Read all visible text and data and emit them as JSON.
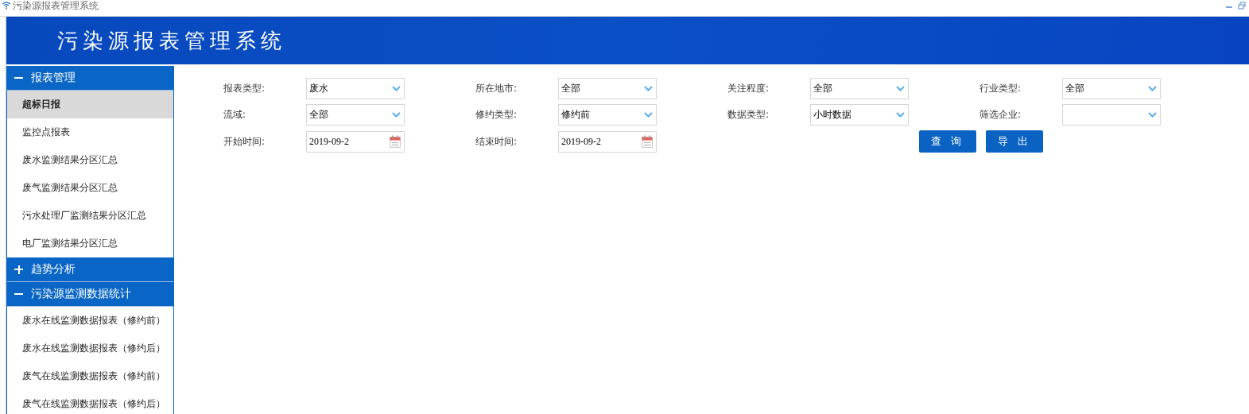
{
  "window": {
    "title": "污染源报表管理系统"
  },
  "header": {
    "title": "污染源报表管理系统"
  },
  "sidebar": {
    "groups": [
      {
        "label": "报表管理",
        "expanded": true,
        "items": [
          {
            "label": "超标日报",
            "selected": true
          },
          {
            "label": "监控点报表",
            "selected": false
          },
          {
            "label": "废水监测结果分区汇总",
            "selected": false
          },
          {
            "label": "废气监测结果分区汇总",
            "selected": false
          },
          {
            "label": "污水处理厂监测结果分区汇总",
            "selected": false
          },
          {
            "label": "电厂监测结果分区汇总",
            "selected": false
          }
        ]
      },
      {
        "label": "趋势分析",
        "expanded": false
      },
      {
        "label": "污染源监测数据统计",
        "expanded": true,
        "items": [
          {
            "label": "废水在线监测数据报表（修约前）",
            "selected": false
          },
          {
            "label": "废水在线监测数据报表（修约后）",
            "selected": false
          },
          {
            "label": "废气在线监测数据报表（修约前）",
            "selected": false
          },
          {
            "label": "废气在线监测数据报表（修约后）",
            "selected": false
          }
        ]
      }
    ]
  },
  "filters": [
    {
      "label": "报表类型:",
      "kind": "select",
      "value": "废水"
    },
    {
      "label": "所在地市:",
      "kind": "select",
      "value": "全部"
    },
    {
      "label": "关注程度:",
      "kind": "select",
      "value": "全部"
    },
    {
      "label": "行业类型:",
      "kind": "select",
      "value": "全部"
    },
    {
      "label": "流域:",
      "kind": "select",
      "value": "全部"
    },
    {
      "label": "修约类型:",
      "kind": "select",
      "value": "修约前"
    },
    {
      "label": "数据类型:",
      "kind": "select",
      "value": "小时数据"
    },
    {
      "label": "筛选企业:",
      "kind": "select"
    },
    {
      "label": "开始时间:",
      "kind": "date",
      "value": "2019-09-2"
    },
    {
      "label": "结束时间:",
      "kind": "date",
      "value": "2019-09-2"
    }
  ],
  "buttons": [
    "查 询",
    "导 出"
  ]
}
